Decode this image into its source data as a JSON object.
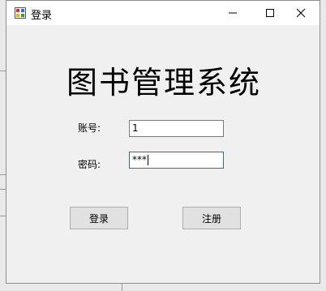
{
  "window": {
    "title": "登录",
    "icon": "app-icon",
    "controls": {
      "minimize_icon": "minimize-icon",
      "maximize_icon": "maximize-icon",
      "close_icon": "close-icon"
    }
  },
  "form": {
    "heading": "图书管理系统",
    "account_label": "账号:",
    "account_value": "1",
    "password_label": "密码:",
    "password_value": "***",
    "login_button": "登录",
    "register_button": "注册"
  },
  "colors": {
    "window_bg": "#f0f0f0",
    "titlebar_bg": "#ffffff",
    "focus_border": "#2a6bbd",
    "button_bg": "#e1e1e1"
  }
}
